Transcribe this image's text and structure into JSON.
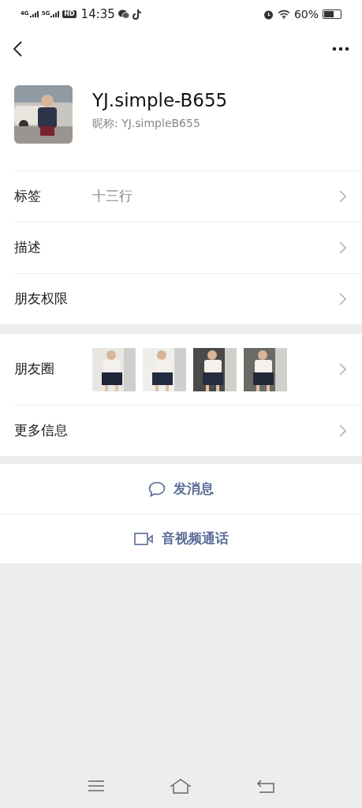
{
  "status_bar": {
    "network_1": "4G",
    "network_2": "5G",
    "hd": "HD",
    "time": "14:35",
    "battery_percent": "60%"
  },
  "contact": {
    "name": "YJ.simple-B655",
    "nickname": "昵称: YJ.simpleB655"
  },
  "info_rows": [
    {
      "label": "标签",
      "value": "十三行"
    },
    {
      "label": "描述"
    },
    {
      "label": "朋友权限"
    }
  ],
  "moments": {
    "label": "朋友圈"
  },
  "more_row": {
    "label": "更多信息"
  },
  "actions": [
    {
      "kind": "message",
      "label": "发消息"
    },
    {
      "kind": "call",
      "label": "音视频通话"
    }
  ]
}
